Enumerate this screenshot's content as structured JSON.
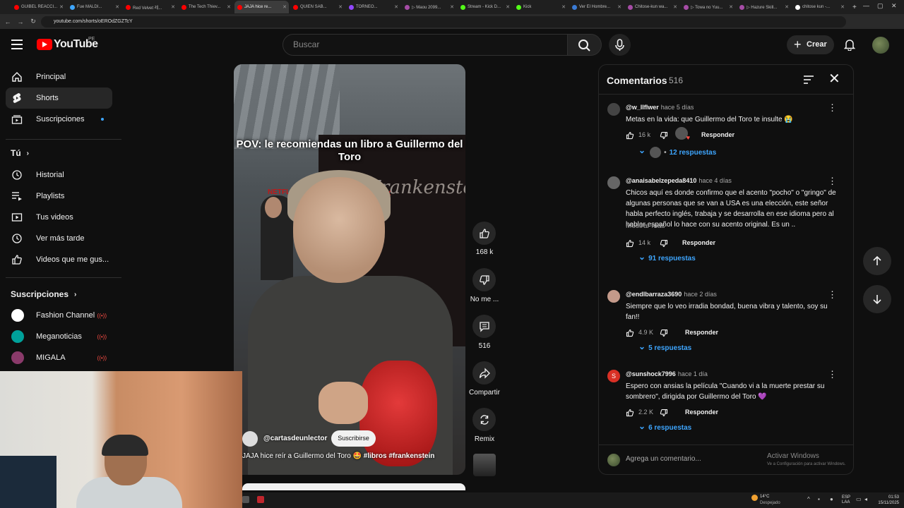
{
  "browser": {
    "tabs": [
      {
        "label": "GUIBEL REACCI...",
        "color": "#ff0000",
        "active": false
      },
      {
        "label": "Fue MALDI...",
        "color": "#3ea6ff",
        "active": false
      },
      {
        "label": "Red Velvet 레...",
        "color": "#ff0000",
        "active": false
      },
      {
        "label": "The Tech Thiev...",
        "color": "#ff0000",
        "active": false
      },
      {
        "label": "JAJA hice re...",
        "color": "#ff0000",
        "active": true
      },
      {
        "label": "QUIEN SAB...",
        "color": "#ff0000",
        "active": false
      },
      {
        "label": "TORNEO...",
        "color": "#9146ff",
        "active": false
      },
      {
        "label": "▷ Maou 2099...",
        "color": "#a64ca6",
        "active": false
      },
      {
        "label": "Stream - Kick D...",
        "color": "#53fc18",
        "active": false
      },
      {
        "label": "Kick",
        "color": "#53fc18",
        "active": false
      },
      {
        "label": "Ver El Hombre...",
        "color": "#3a7bd5",
        "active": false
      },
      {
        "label": "Chitose-kun wa...",
        "color": "#a64ca6",
        "active": false
      },
      {
        "label": "▷ Towa no Yuu...",
        "color": "#a64ca6",
        "active": false
      },
      {
        "label": "▷ Hazure Skill...",
        "color": "#a64ca6",
        "active": false
      },
      {
        "label": "chitose kun -...",
        "color": "#ffffff",
        "active": false
      }
    ],
    "url": "youtube.com/shorts/oEROdZGZTcY"
  },
  "header": {
    "wordmark": "YouTube",
    "country": "PE",
    "search_placeholder": "Buscar",
    "create_label": "Crear"
  },
  "sidebar": {
    "main": [
      {
        "label": "Principal",
        "icon": "home-icon",
        "active": false
      },
      {
        "label": "Shorts",
        "icon": "shorts-icon",
        "active": true
      },
      {
        "label": "Suscripciones",
        "icon": "subscriptions-icon",
        "active": false
      }
    ],
    "you_title": "Tú",
    "you": [
      {
        "label": "Historial",
        "icon": "history-icon"
      },
      {
        "label": "Playlists",
        "icon": "playlists-icon"
      },
      {
        "label": "Tus videos",
        "icon": "your-videos-icon"
      },
      {
        "label": "Ver más tarde",
        "icon": "watch-later-icon"
      },
      {
        "label": "Videos que me gus...",
        "icon": "liked-videos-icon"
      }
    ],
    "subs_title": "Suscripciones",
    "subs": [
      {
        "label": "Fashion Channel",
        "color": "#ffffff"
      },
      {
        "label": "Meganoticias",
        "color": "#00a19a"
      },
      {
        "label": "MIGALA",
        "color": "#8a3a6a"
      }
    ]
  },
  "short": {
    "caption": "POV: le recomiendas un libro a Guillermo del Toro",
    "backdrop_text": "Frankenstein",
    "netflix": "NETFLIX",
    "channel": "@cartasdeunlector",
    "subscribe": "Suscribirse",
    "title_prefix": "JAJA hice reír a Guillermo del Toro 🤩 ",
    "title_tags": "#libros #frankenstein"
  },
  "actions": {
    "likes": "168 k",
    "dislike": "No me ...",
    "comments": "516",
    "share": "Compartir",
    "remix": "Remix"
  },
  "comments": {
    "title": "Comentarios",
    "count": "516",
    "items": [
      {
        "author": "@w_llflwer",
        "time": "hace 5 días",
        "text": "Metas en la vida: que Guillermo del Toro te insulte 😭",
        "more": "",
        "likes": "16 k",
        "reply": "Responder",
        "replies": "12 respuestas",
        "color": "#444444"
      },
      {
        "author": "@anaisabelzepeda8410",
        "time": "hace 4 días",
        "text": "Chicos aquí es donde confirmo que el acento \"pocho\" o \"gringo\" de algunas personas que se van a USA es una elección, este señor habla perfecto inglés, trabaja y se desarrolla en ese idioma pero al hablar español lo hace con su acento original. Es un ..",
        "more": "Mostrar más",
        "likes": "14 k",
        "reply": "Responder",
        "replies": "91 respuestas",
        "color": "#666666"
      },
      {
        "author": "@endlbarraza3690",
        "time": "hace 2 días",
        "text": "Siempre que lo veo irradia bondad, buena vibra y talento, soy su fan!!",
        "more": "",
        "likes": "4.9 K",
        "reply": "Responder",
        "replies": "5 respuestas",
        "color": "#c49a8a"
      },
      {
        "author": "@sunshock7996",
        "time": "hace 1 día",
        "text": "Espero con ansias la película \"Cuando vi a la muerte prestar su sombrero\", dirigida por Guillermo del Toro 💜",
        "more": "",
        "likes": "2.2 K",
        "reply": "Responder",
        "replies": "6 respuestas",
        "color": "#d93025",
        "initial": "S"
      }
    ],
    "add_placeholder": "Agrega un comentario...",
    "activate_title": "Activar Windows",
    "activate_sub": "Ve a Configuración para activar Windows."
  },
  "taskbar": {
    "temp": "14°C",
    "weather": "Despejado",
    "lang1": "ESP",
    "lang2": "LAA",
    "time": "01:53",
    "date": "15/11/2025"
  }
}
